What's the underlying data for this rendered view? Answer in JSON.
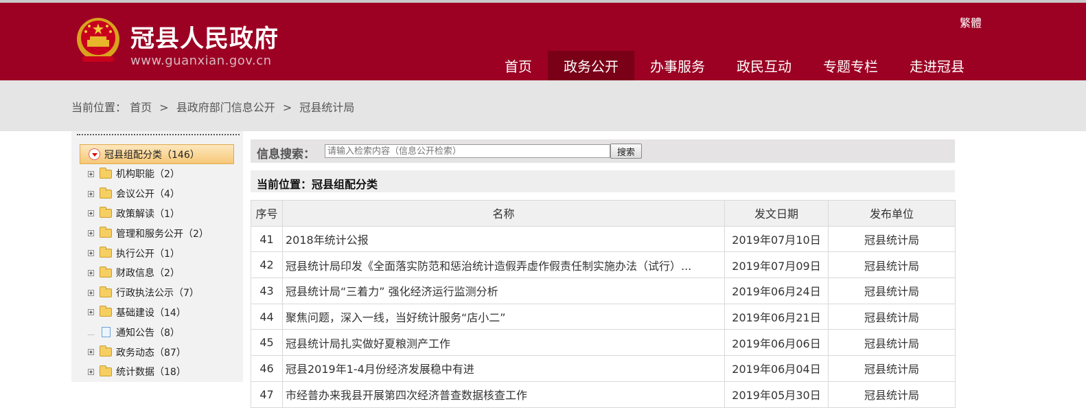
{
  "header": {
    "site_title": "冠县人民政府",
    "site_url": "www.guanxian.gov.cn",
    "lang_toggle": "繁體",
    "nav": [
      {
        "label": "首页"
      },
      {
        "label": "政务公开",
        "active": true
      },
      {
        "label": "办事服务"
      },
      {
        "label": "政民互动"
      },
      {
        "label": "专题专栏"
      },
      {
        "label": "走进冠县"
      }
    ],
    "brand_color": "#9c0023"
  },
  "breadcrumb": {
    "prefix": "当前位置：",
    "items": [
      "首页",
      "县政府部门信息公开",
      "冠县统计局"
    ],
    "separator": ">"
  },
  "sidebar": {
    "root": {
      "label": "冠县组配分类（146）",
      "icon": "expand-down-icon"
    },
    "items": [
      {
        "label": "机构职能（2）",
        "icon": "folder-icon"
      },
      {
        "label": "会议公开（4）",
        "icon": "folder-icon"
      },
      {
        "label": "政策解读（1）",
        "icon": "folder-icon"
      },
      {
        "label": "管理和服务公开（2）",
        "icon": "folder-icon"
      },
      {
        "label": "执行公开（1）",
        "icon": "folder-icon"
      },
      {
        "label": "财政信息（2）",
        "icon": "folder-icon"
      },
      {
        "label": "行政执法公示（7）",
        "icon": "folder-icon"
      },
      {
        "label": "基础建设（14）",
        "icon": "folder-icon"
      },
      {
        "label": "通知公告（8）",
        "icon": "document-icon"
      },
      {
        "label": "政务动态（87）",
        "icon": "folder-icon"
      },
      {
        "label": "统计数据（18）",
        "icon": "folder-icon"
      }
    ]
  },
  "search": {
    "label": "信息搜索：",
    "placeholder": "请输入检索内容（信息公开检索）",
    "button": "搜索"
  },
  "location": {
    "label": "当前位置：冠县组配分类"
  },
  "table": {
    "headers": [
      "序号",
      "名称",
      "发文日期",
      "发布单位"
    ],
    "rows": [
      [
        "41",
        "2018年统计公报",
        "2019年07月10日",
        "冠县统计局"
      ],
      [
        "42",
        "冠县统计局印发《全面落实防范和惩治统计造假弄虚作假责任制实施办法（试行）...",
        "2019年07月09日",
        "冠县统计局"
      ],
      [
        "43",
        "冠县统计局“三着力” 强化经济运行监测分析",
        "2019年06月24日",
        "冠县统计局"
      ],
      [
        "44",
        "聚焦问题，深入一线，当好统计服务“店小二”",
        "2019年06月21日",
        "冠县统计局"
      ],
      [
        "45",
        "冠县统计局扎实做好夏粮测产工作",
        "2019年06月06日",
        "冠县统计局"
      ],
      [
        "46",
        "冠县2019年1-4月份经济发展稳中有进",
        "2019年06月04日",
        "冠县统计局"
      ],
      [
        "47",
        "市经普办来我县开展第四次经济普查数据核查工作",
        "2019年05月30日",
        "冠县统计局"
      ]
    ]
  }
}
